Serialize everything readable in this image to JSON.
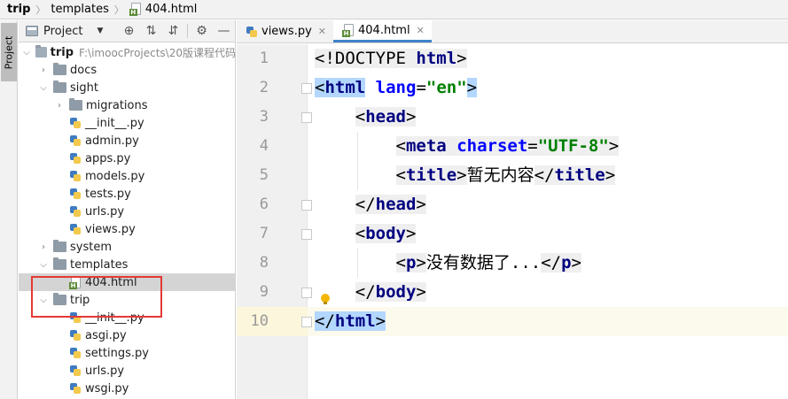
{
  "breadcrumb": {
    "root": "trip",
    "folder": "templates",
    "file": "404.html"
  },
  "tool_strip": {
    "project_tab": "Project"
  },
  "project_panel": {
    "title": "Project",
    "tool_icons": [
      "locate-icon",
      "expand-all-icon",
      "collapse-all-icon",
      "gear-icon",
      "hide-icon"
    ]
  },
  "tree": {
    "root": {
      "name": "trip",
      "path": "F:\\imoocProjects\\20版课程代码"
    },
    "docs": "docs",
    "sight": "sight",
    "migrations": "migrations",
    "sight_init": "__init__.py",
    "admin": "admin.py",
    "apps": "apps.py",
    "models": "models.py",
    "tests": "tests.py",
    "sight_urls": "urls.py",
    "views": "views.py",
    "system": "system",
    "templates": "templates",
    "file_404": "404.html",
    "trip_pkg": "trip",
    "trip_init": "__init__.py",
    "asgi": "asgi.py",
    "settings": "settings.py",
    "trip_urls": "urls.py",
    "wsgi": "wsgi.py"
  },
  "editor_tabs": [
    {
      "label": "views.py",
      "icon": "python-file-icon"
    },
    {
      "label": "404.html",
      "icon": "html-file-icon",
      "active": true
    }
  ],
  "editor": {
    "current_line": 10,
    "line_numbers": [
      "1",
      "2",
      "3",
      "4",
      "5",
      "6",
      "7",
      "8",
      "9",
      "10"
    ],
    "code": {
      "l1_open": "<!DOCTYPE ",
      "l1_kw": "html",
      "l1_close": ">",
      "lt": "<",
      "gt": ">",
      "lt_slash": "</",
      "eq": "=",
      "tag_html": "html",
      "attr_lang": "lang",
      "val_en": "\"en\"",
      "tag_head": "head",
      "tag_meta": "meta",
      "attr_charset": "charset",
      "val_utf8": "\"UTF-8\"",
      "tag_title": "title",
      "title_text": "暂无内容",
      "tag_body": "body",
      "tag_p": "p",
      "p_text": "没有数据了..."
    }
  },
  "colors": {
    "tag": "#000080",
    "attribute": "#0000ff",
    "string": "#008000",
    "highlight_box": "#e53935",
    "tag_match": "#b3d7fe",
    "active_tab_underline": "#4083c9"
  }
}
